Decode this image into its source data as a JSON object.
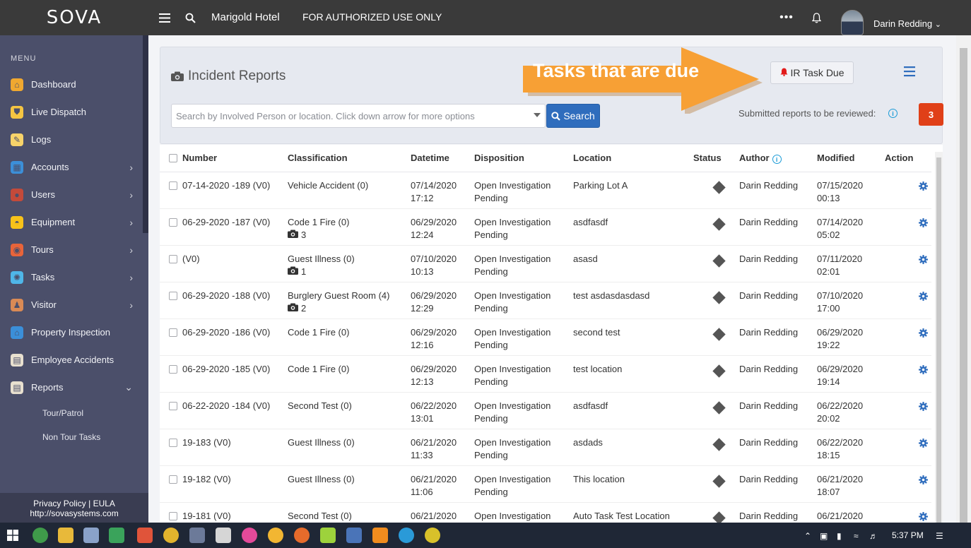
{
  "topbar": {
    "logo": "SOVA",
    "property": "Marigold Hotel",
    "notice": "FOR AUTHORIZED USE ONLY",
    "user": "Darin Redding",
    "icons": [
      "menu-icon",
      "search-icon",
      "more-icon",
      "bell-icon",
      "chevron-down-icon"
    ]
  },
  "sidebar": {
    "menu_label": "MENU",
    "items": [
      {
        "label": "Dashboard",
        "icon": "home-icon",
        "color": "#f0a830",
        "expandable": false
      },
      {
        "label": "Live Dispatch",
        "icon": "shield-icon",
        "color": "#f5c542",
        "expandable": false
      },
      {
        "label": "Logs",
        "icon": "pencil-icon",
        "color": "#f7d36a",
        "expandable": false
      },
      {
        "label": "Accounts",
        "icon": "accounts-icon",
        "color": "#3c8fd8",
        "expandable": true
      },
      {
        "label": "Users",
        "icon": "user-icon",
        "color": "#c44a3a",
        "expandable": true
      },
      {
        "label": "Equipment",
        "icon": "helmet-icon",
        "color": "#f7c21a",
        "expandable": true
      },
      {
        "label": "Tours",
        "icon": "tours-icon",
        "color": "#e8643a",
        "expandable": true
      },
      {
        "label": "Tasks",
        "icon": "tasks-icon",
        "color": "#4fb6e8",
        "expandable": true
      },
      {
        "label": "Visitor",
        "icon": "visitor-icon",
        "color": "#d98a55",
        "expandable": true
      },
      {
        "label": "Property Inspection",
        "icon": "inspection-icon",
        "color": "#3b8fd9",
        "expandable": false
      },
      {
        "label": "Employee Accidents",
        "icon": "clipboard-icon",
        "color": "#e8e0cf",
        "expandable": false
      },
      {
        "label": "Reports",
        "icon": "reports-icon",
        "color": "#e8e0cf",
        "expandable": true,
        "expanded": true
      }
    ],
    "sub_items": [
      "Tour/Patrol",
      "Non Tour Tasks"
    ],
    "footer": {
      "privacy": "Privacy Policy",
      "separator": "|",
      "eula": "EULA",
      "url": "http://sovasystems.com"
    }
  },
  "header": {
    "title": "Incident Reports",
    "callout": "Tasks that are due",
    "ir_task_button": "IR Task Due",
    "search_placeholder": "Search by Involved Person or location. Click down arrow for more options",
    "search_button": "Search",
    "review_label": "Submitted reports to be reviewed:",
    "review_count": "3",
    "colors": {
      "accent": "#2f6dbd",
      "badge": "#e04018",
      "callout": "#f7a035",
      "bell": "#e21b1b"
    }
  },
  "table": {
    "columns": [
      "Number",
      "Classification",
      "Datetime",
      "Disposition",
      "Location",
      "Status",
      "Author",
      "Modified",
      "Action"
    ],
    "rows": [
      {
        "number": "07-14-2020 -189 (V0)",
        "classification": "Vehicle Accident (0)",
        "photos": "",
        "date": "07/14/2020",
        "time": "17:12",
        "disp1": "Open Investigation",
        "disp2": "Pending",
        "location": "Parking Lot A",
        "author": "Darin Redding",
        "mod_date": "07/15/2020",
        "mod_time": "00:13"
      },
      {
        "number": "06-29-2020 -187 (V0)",
        "classification": "Code 1 Fire (0)",
        "photos": "3",
        "date": "06/29/2020",
        "time": "12:24",
        "disp1": "Open Investigation",
        "disp2": "Pending",
        "location": "asdfasdf",
        "author": "Darin Redding",
        "mod_date": "07/14/2020",
        "mod_time": "05:02"
      },
      {
        "number": "(V0)",
        "classification": "Guest Illness (0)",
        "photos": "1",
        "date": "07/10/2020",
        "time": "10:13",
        "disp1": "Open Investigation",
        "disp2": "Pending",
        "location": "asasd",
        "author": "Darin Redding",
        "mod_date": "07/11/2020",
        "mod_time": "02:01"
      },
      {
        "number": "06-29-2020 -188 (V0)",
        "classification": "Burglery Guest Room (4)",
        "photos": "2",
        "date": "06/29/2020",
        "time": "12:29",
        "disp1": "Open Investigation",
        "disp2": "Pending",
        "location": "test asdasdasdasd",
        "author": "Darin Redding",
        "mod_date": "07/10/2020",
        "mod_time": "17:00"
      },
      {
        "number": "06-29-2020 -186 (V0)",
        "classification": "Code 1 Fire (0)",
        "photos": "",
        "date": "06/29/2020",
        "time": "12:16",
        "disp1": "Open Investigation",
        "disp2": "Pending",
        "location": "second test",
        "author": "Darin Redding",
        "mod_date": "06/29/2020",
        "mod_time": "19:22"
      },
      {
        "number": "06-29-2020 -185 (V0)",
        "classification": "Code 1 Fire (0)",
        "photos": "",
        "date": "06/29/2020",
        "time": "12:13",
        "disp1": "Open Investigation",
        "disp2": "Pending",
        "location": "test location",
        "author": "Darin Redding",
        "mod_date": "06/29/2020",
        "mod_time": "19:14"
      },
      {
        "number": "06-22-2020 -184 (V0)",
        "classification": "Second Test (0)",
        "photos": "",
        "date": "06/22/2020",
        "time": "13:01",
        "disp1": "Open Investigation",
        "disp2": "Pending",
        "location": "asdfasdf",
        "author": "Darin Redding",
        "mod_date": "06/22/2020",
        "mod_time": "20:02"
      },
      {
        "number": "19-183 (V0)",
        "classification": "Guest Illness (0)",
        "photos": "",
        "date": "06/21/2020",
        "time": "11:33",
        "disp1": "Open Investigation",
        "disp2": "Pending",
        "location": "asdads",
        "author": "Darin Redding",
        "mod_date": "06/22/2020",
        "mod_time": "18:15"
      },
      {
        "number": "19-182 (V0)",
        "classification": "Guest Illness (0)",
        "photos": "",
        "date": "06/21/2020",
        "time": "11:06",
        "disp1": "Open Investigation",
        "disp2": "Pending",
        "location": "This location",
        "author": "Darin Redding",
        "mod_date": "06/21/2020",
        "mod_time": "18:07"
      },
      {
        "number": "19-181 (V0)",
        "classification": "Second Test (0)",
        "photos": "",
        "date": "06/21/2020",
        "time": "",
        "disp1": "Open Investigation",
        "disp2": "",
        "location": "Auto Task Test Location",
        "author": "Darin Redding",
        "mod_date": "06/21/2020",
        "mod_time": ""
      }
    ]
  },
  "taskbar": {
    "time": "5:37 PM"
  }
}
